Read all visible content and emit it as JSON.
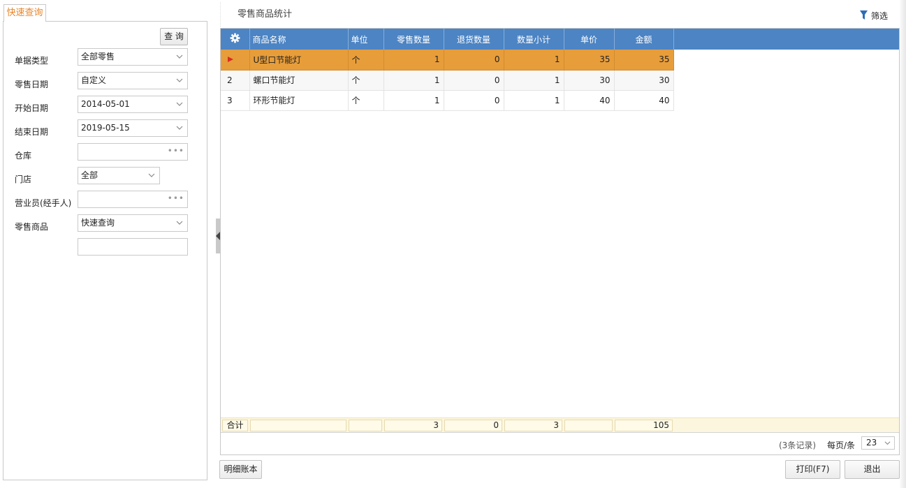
{
  "left": {
    "tab_label": "快速查询",
    "query_button": "查 询",
    "fields": [
      {
        "label": "单据类型",
        "value": "全部零售",
        "kind": "select"
      },
      {
        "label": "零售日期",
        "value": "自定义",
        "kind": "select"
      },
      {
        "label": "开始日期",
        "value": "2014-05-01",
        "kind": "select"
      },
      {
        "label": "结束日期",
        "value": "2019-05-15",
        "kind": "select"
      },
      {
        "label": "仓库",
        "value": "",
        "kind": "lookup"
      },
      {
        "label": "门店",
        "value": "全部",
        "kind": "select"
      },
      {
        "label": "营业员(经手人)",
        "value": "",
        "kind": "lookup"
      },
      {
        "label": "零售商品",
        "value": "快速查询",
        "kind": "select"
      },
      {
        "label": "",
        "value": "",
        "kind": "text"
      }
    ]
  },
  "main": {
    "title": "零售商品统计",
    "filter_label": "筛选",
    "columns": [
      "商品名称",
      "单位",
      "零售数量",
      "退货数量",
      "数量小计",
      "单价",
      "金额"
    ],
    "rows": [
      {
        "idx": "",
        "selected": true,
        "cells": [
          "U型口节能灯",
          "个",
          "1",
          "0",
          "1",
          "35",
          "35"
        ]
      },
      {
        "idx": "2",
        "selected": false,
        "cells": [
          "螺口节能灯",
          "个",
          "1",
          "0",
          "1",
          "30",
          "30"
        ]
      },
      {
        "idx": "3",
        "selected": false,
        "cells": [
          "环形节能灯",
          "个",
          "1",
          "0",
          "1",
          "40",
          "40"
        ]
      }
    ],
    "totals": {
      "label": "合计",
      "retail_qty": "3",
      "return_qty": "0",
      "subtotal_qty": "3",
      "amount": "105"
    },
    "pager": {
      "records": "(3条记录)",
      "per_page_label": "每页/条",
      "per_page": "23"
    }
  },
  "buttons": {
    "detail": "明细账本",
    "print": "打印(F7)",
    "exit": "退出"
  },
  "colors": {
    "header": "#4c84c4",
    "selected_row": "#e79d3a",
    "accent": "#e8862a",
    "total_bar": "#fdf6de"
  }
}
